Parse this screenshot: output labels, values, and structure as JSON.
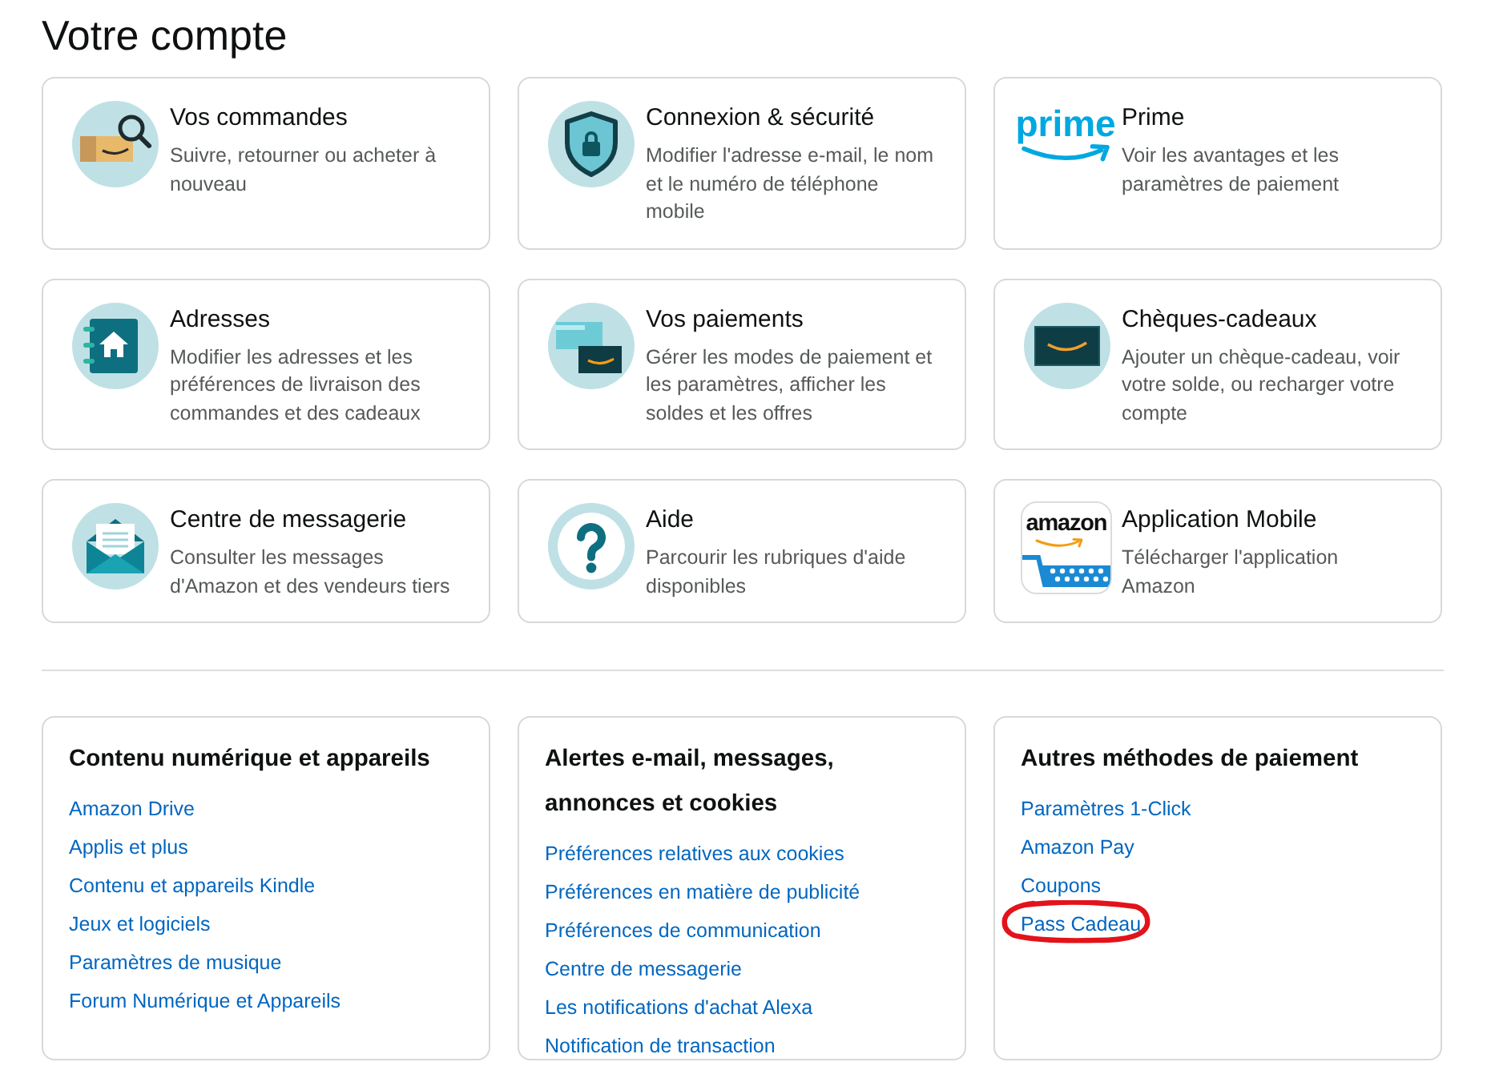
{
  "page": {
    "title": "Votre compte"
  },
  "account_cards": [
    {
      "title": "Vos commandes",
      "description": "Suivre, retourner ou acheter à nouveau"
    },
    {
      "title": "Connexion & sécurité",
      "description": "Modifier l'adresse e-mail, le nom et le numéro de téléphone mobile"
    },
    {
      "title": "Prime",
      "description": "Voir les avantages et les paramètres de paiement",
      "logo_text": "prime"
    },
    {
      "title": "Adresses",
      "description": "Modifier les adresses et les préférences de livraison des commandes et des cadeaux"
    },
    {
      "title": "Vos paiements",
      "description": "Gérer les modes de paiement et les paramètres, afficher les soldes et les offres"
    },
    {
      "title": "Chèques-cadeaux",
      "description": "Ajouter un chèque-cadeau, voir votre solde, ou recharger votre compte"
    },
    {
      "title": "Centre de messagerie",
      "description": "Consulter les messages d'Amazon et des vendeurs tiers"
    },
    {
      "title": "Aide",
      "description": "Parcourir les rubriques d'aide disponibles"
    },
    {
      "title": "Application Mobile",
      "description": "Télécharger l'application Amazon",
      "logo_text": "amazon"
    }
  ],
  "link_sections": [
    {
      "heading": "Contenu numérique et appareils",
      "links": [
        {
          "label": "Amazon Drive",
          "circled": false
        },
        {
          "label": "Applis et plus",
          "circled": false
        },
        {
          "label": "Contenu et appareils Kindle",
          "circled": false
        },
        {
          "label": "Jeux et logiciels",
          "circled": false
        },
        {
          "label": "Paramètres de musique",
          "circled": false
        },
        {
          "label": "Forum Numérique et Appareils",
          "circled": false
        }
      ]
    },
    {
      "heading": "Alertes e-mail, messages, annonces et cookies",
      "links": [
        {
          "label": "Préférences relatives aux cookies",
          "circled": false
        },
        {
          "label": "Préférences en matière de publicité",
          "circled": false
        },
        {
          "label": "Préférences de communication",
          "circled": false
        },
        {
          "label": "Centre de messagerie",
          "circled": false
        },
        {
          "label": "Les notifications d'achat Alexa",
          "circled": false
        },
        {
          "label": "Notification de transaction",
          "circled": false
        }
      ]
    },
    {
      "heading": "Autres méthodes de paiement",
      "links": [
        {
          "label": "Paramètres 1-Click",
          "circled": false
        },
        {
          "label": "Amazon Pay",
          "circled": false
        },
        {
          "label": "Coupons",
          "circled": false
        },
        {
          "label": "Pass Cadeau",
          "circled": true
        }
      ]
    }
  ]
}
